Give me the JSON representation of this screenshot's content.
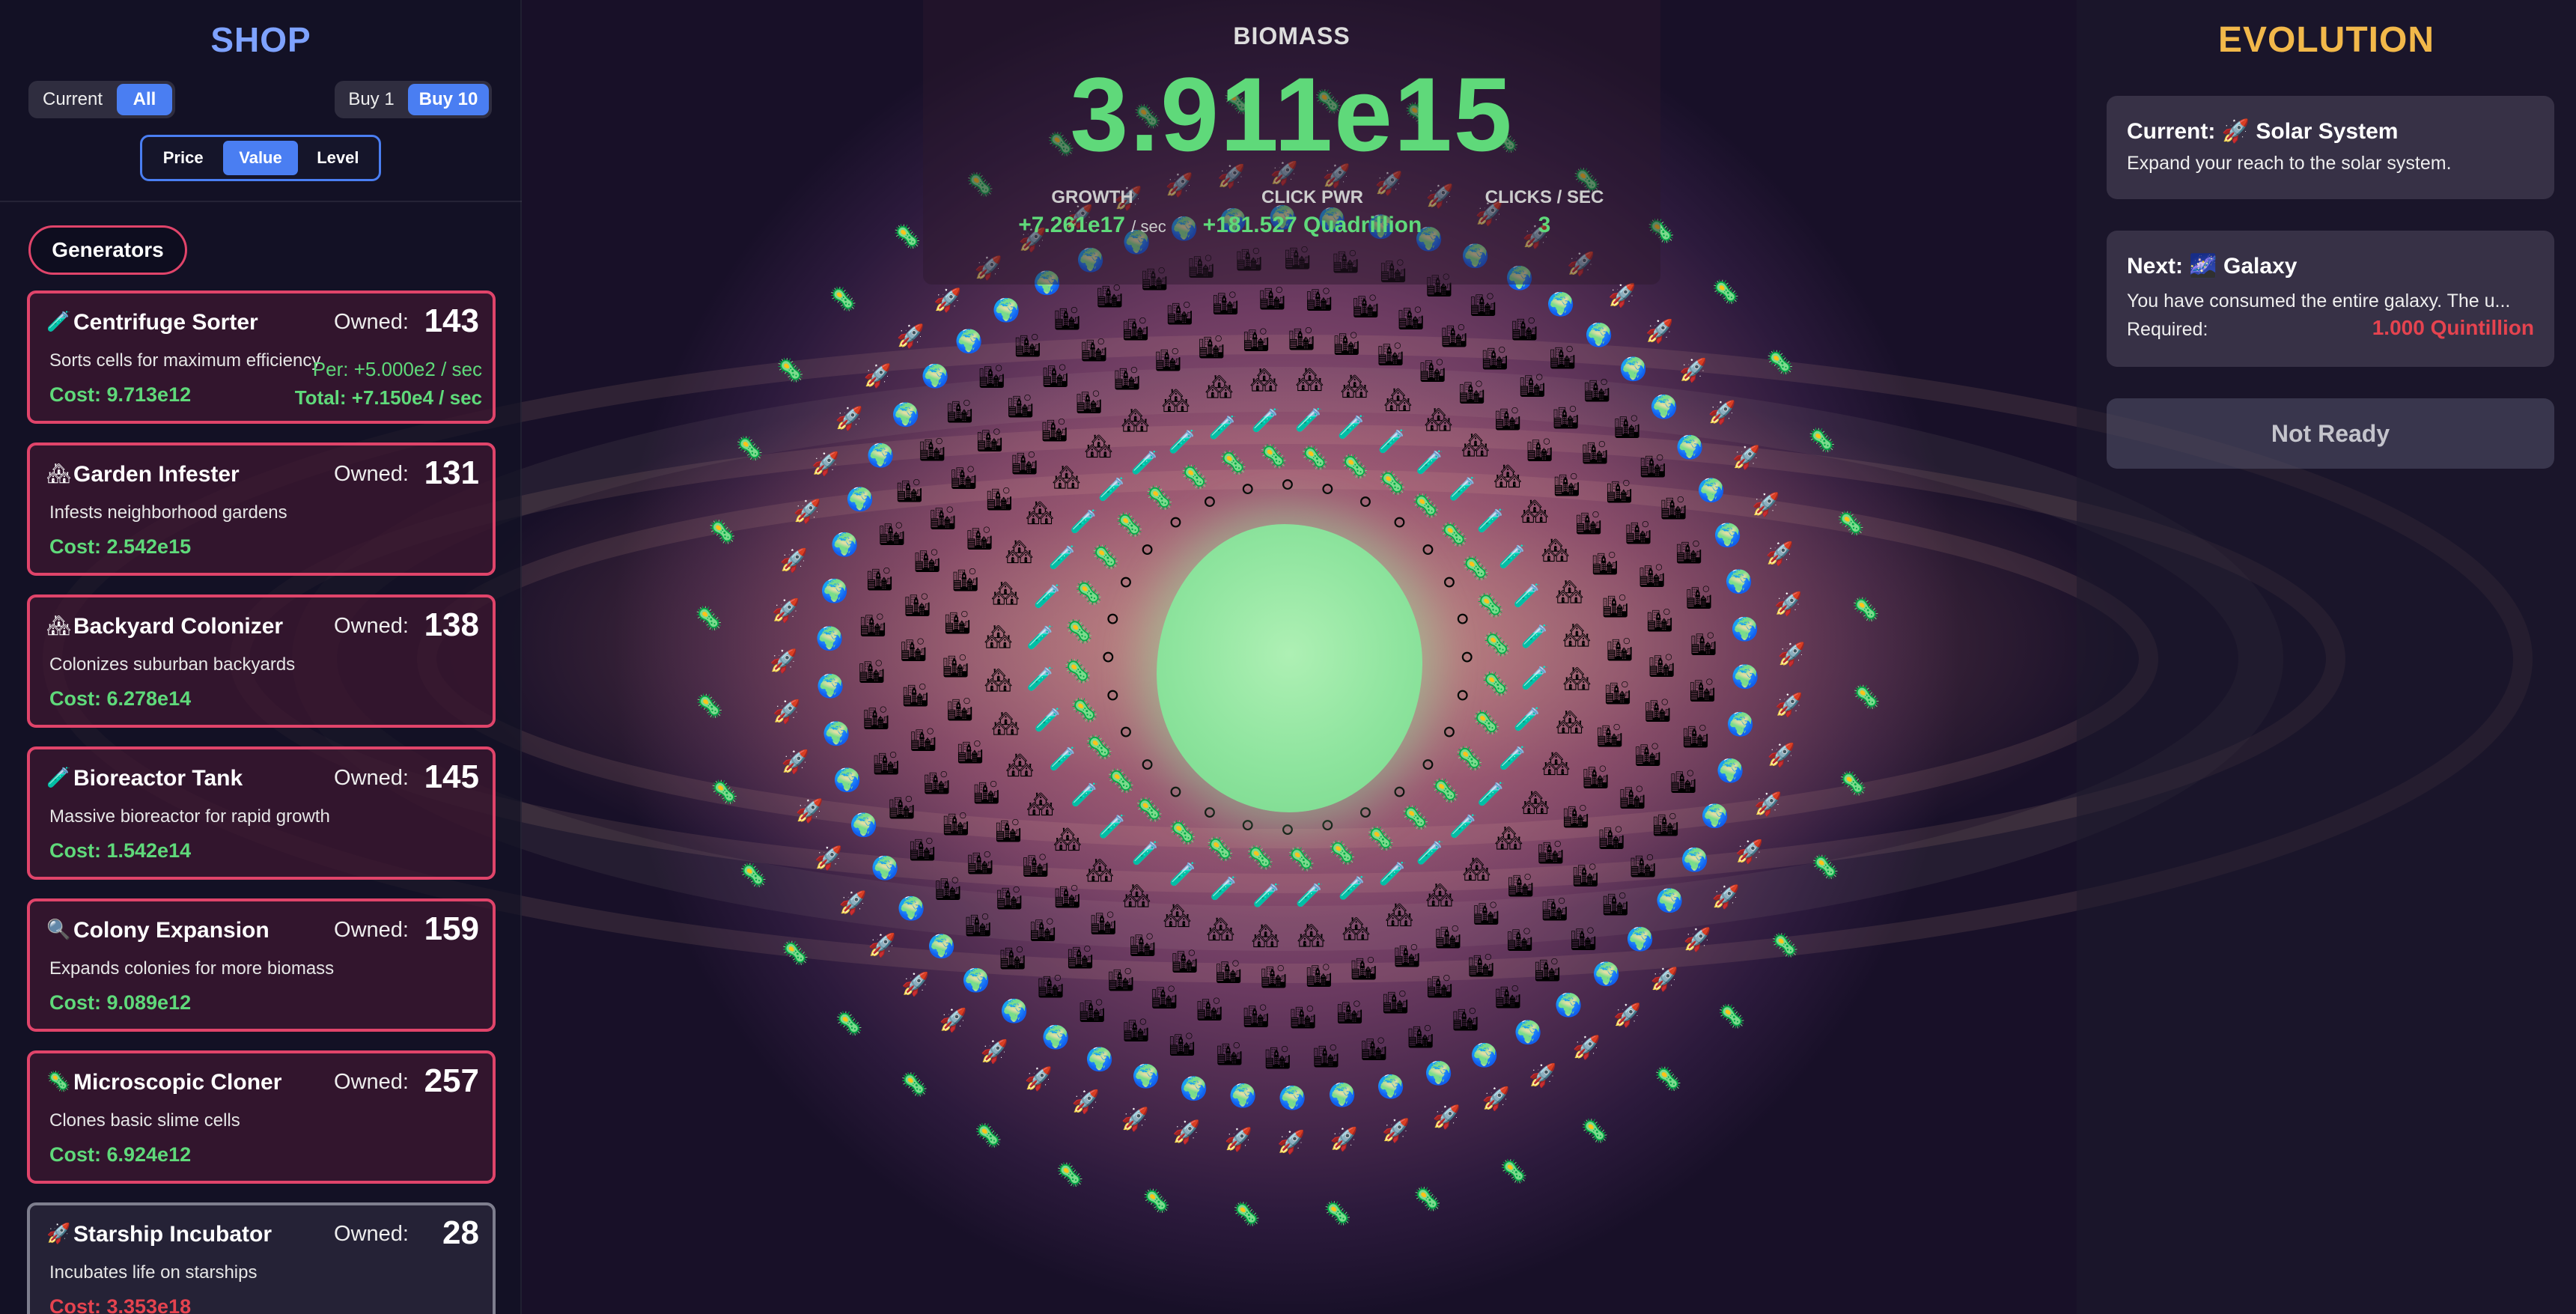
{
  "shop": {
    "title": "SHOP",
    "filter": [
      "Current",
      "All"
    ],
    "filter_selected": "All",
    "buy": [
      "Buy 1",
      "Buy 10"
    ],
    "buy_selected": "Buy 10",
    "sort": [
      "Price",
      "Value",
      "Level"
    ],
    "sort_selected": "Value",
    "section_tab": "Generators",
    "generators": [
      {
        "icon": "test-tube-icon",
        "glyph": "🧪",
        "name": "Centrifuge Sorter",
        "owned_label": "Owned:",
        "owned": "143",
        "desc": "Sorts cells for maximum efficiency",
        "cost": "Cost: 9.713e12",
        "per": "Per: +5.000e2 / sec",
        "total": "Total: +7.150e4 / sec",
        "affordable": true
      },
      {
        "icon": "house-icon",
        "glyph": "🏘",
        "name": "Garden Infester",
        "owned_label": "Owned:",
        "owned": "131",
        "desc": "Infests neighborhood gardens",
        "cost": "Cost: 2.542e15",
        "affordable": true
      },
      {
        "icon": "house-icon",
        "glyph": "🏘",
        "name": "Backyard Colonizer",
        "owned_label": "Owned:",
        "owned": "138",
        "desc": "Colonizes suburban backyards",
        "cost": "Cost: 6.278e14",
        "affordable": true
      },
      {
        "icon": "test-tube-icon",
        "glyph": "🧪",
        "name": "Bioreactor Tank",
        "owned_label": "Owned:",
        "owned": "145",
        "desc": "Massive bioreactor for rapid growth",
        "cost": "Cost: 1.542e14",
        "affordable": true
      },
      {
        "icon": "magnifier-icon",
        "glyph": "🔍",
        "name": "Colony Expansion",
        "owned_label": "Owned:",
        "owned": "159",
        "desc": "Expands colonies for more biomass",
        "cost": "Cost: 9.089e12",
        "affordable": true
      },
      {
        "icon": "microbe-icon",
        "glyph": "🦠",
        "name": "Microscopic Cloner",
        "owned_label": "Owned:",
        "owned": "257",
        "desc": "Clones basic slime cells",
        "cost": "Cost: 6.924e12",
        "affordable": true
      },
      {
        "icon": "rocket-icon",
        "glyph": "🚀",
        "name": "Starship Incubator",
        "owned_label": "Owned:",
        "owned": "28",
        "desc": "Incubates life on starships",
        "cost": "Cost: 3.353e18",
        "affordable": false
      }
    ]
  },
  "stats": {
    "biomass_label": "BIOMASS",
    "biomass_value": "3.911e15",
    "growth_label": "GROWTH",
    "growth_value": "+7.261e17",
    "growth_unit": "/ sec",
    "click_label": "CLICK PWR",
    "click_value": "+181.527 Quadrillion",
    "clicks_label": "CLICKS / SEC",
    "clicks_value": "3"
  },
  "evolution": {
    "title": "EVOLUTION",
    "current_heading": "Current: 🚀 Solar System",
    "current_desc": "Expand your reach to the solar system.",
    "next_heading": "Next: 🌌 Galaxy",
    "next_desc": "You have consumed the entire galaxy. The u...",
    "required_label": "Required:",
    "required_value": "1.000 Quintillion",
    "button_label": "Not Ready"
  },
  "colors": {
    "accent": "#4a7ef2",
    "card_border": "#e0446a",
    "positive": "#5fd97a",
    "negative": "#e5434f",
    "evo_title": "#f2b84a",
    "shop_title": "#7ea2ff"
  }
}
